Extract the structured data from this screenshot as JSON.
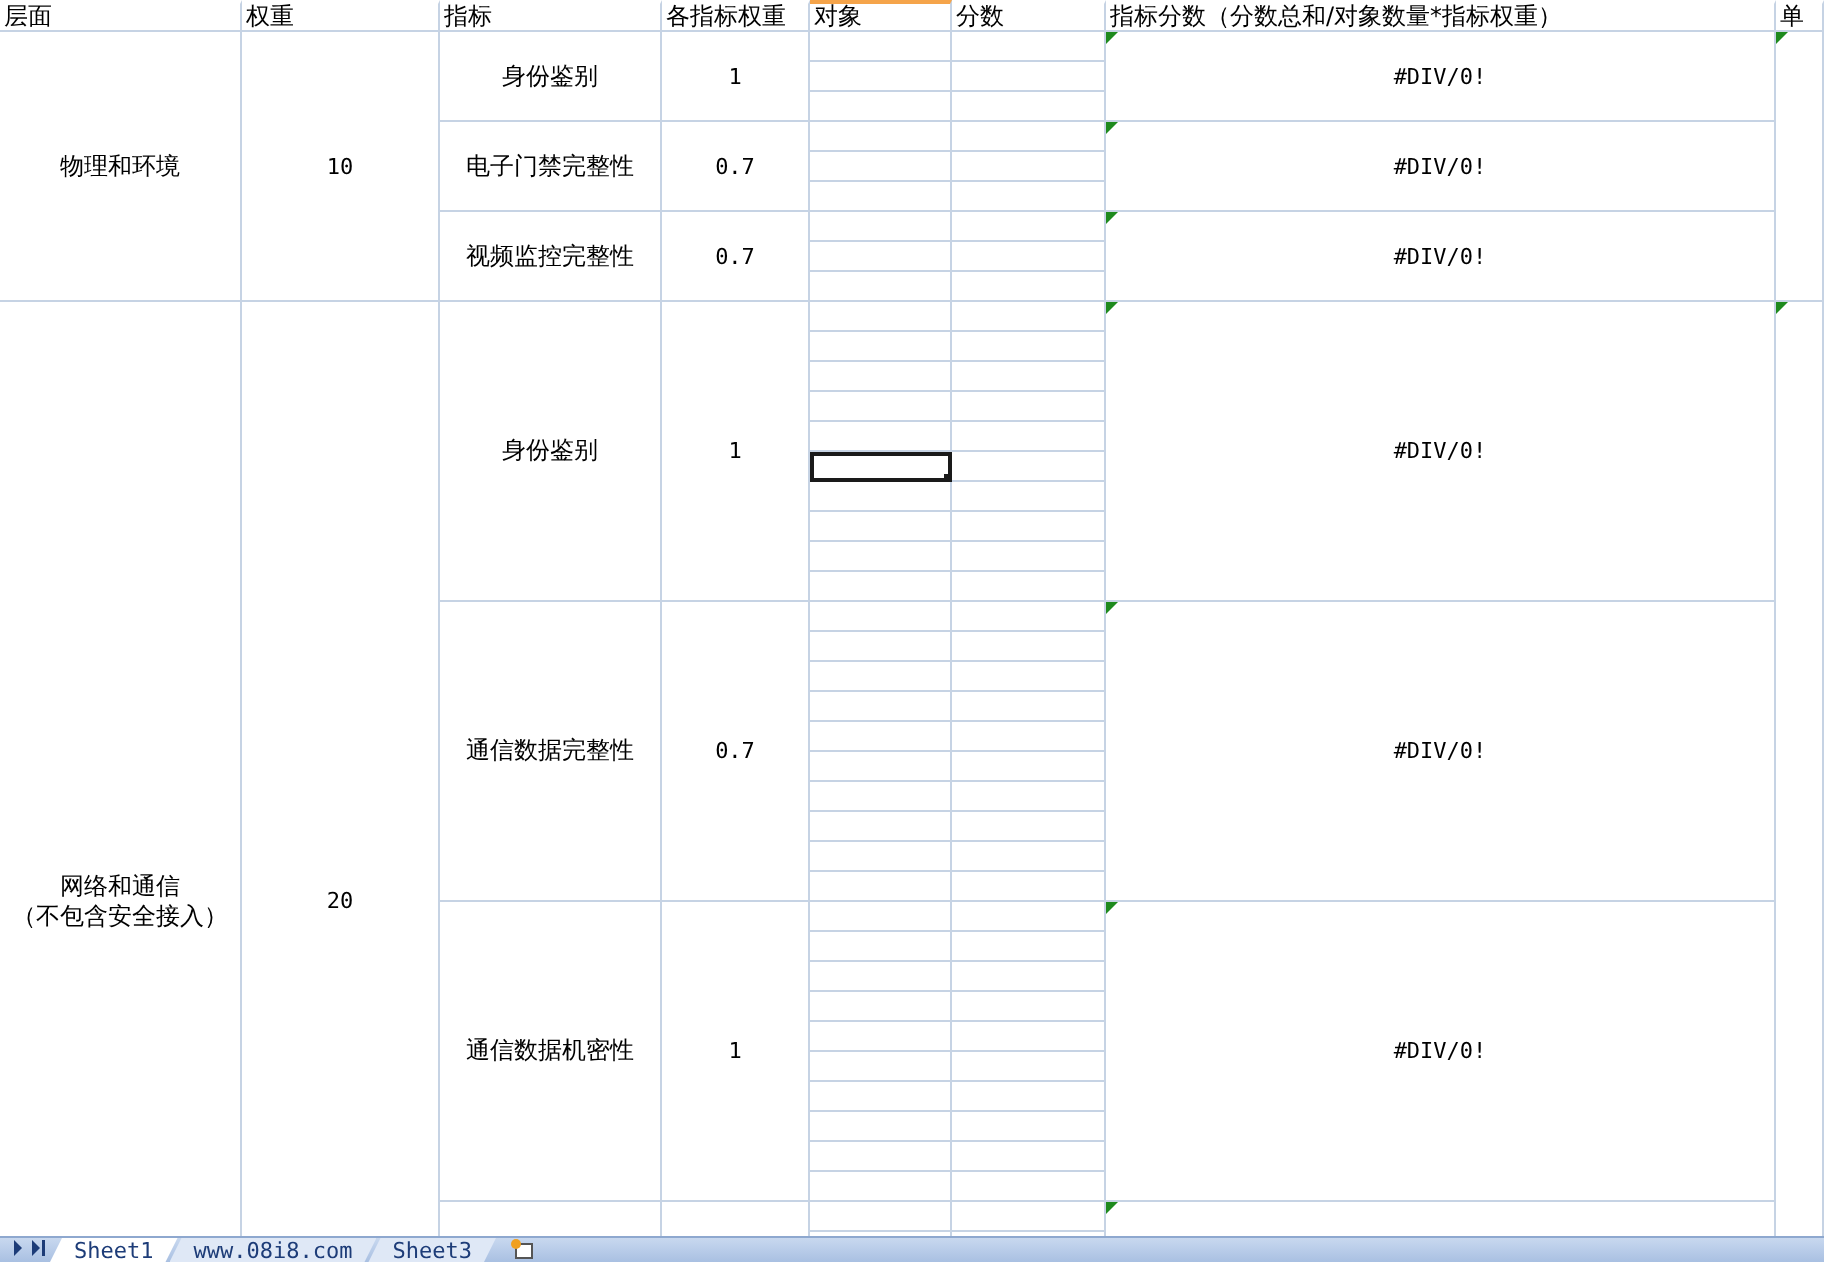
{
  "columns": [
    "层面",
    "权重",
    "指标",
    "各指标权重",
    "对象",
    "分数",
    "指标分数（分数总和/对象数量*指标权重）",
    "单"
  ],
  "groups": [
    {
      "kind": "short",
      "layer": [
        "物理和环境"
      ],
      "weight": "10",
      "flagged": true,
      "indicators": [
        {
          "name": "身份鉴别",
          "weight": "1",
          "score": "#DIV/0!",
          "flagged": true,
          "object_cells": [
            {
              "selected": false
            },
            {
              "selected": false
            },
            {
              "selected": false
            }
          ]
        },
        {
          "name": "电子门禁完整性",
          "weight": "0.7",
          "score": "#DIV/0!",
          "flagged": true,
          "object_cells": [
            {
              "selected": false
            },
            {
              "selected": false
            },
            {
              "selected": false
            }
          ]
        },
        {
          "name": "视频监控完整性",
          "weight": "0.7",
          "score": "#DIV/0!",
          "flagged": true,
          "object_cells": [
            {
              "selected": false
            },
            {
              "selected": false
            },
            {
              "selected": false
            }
          ]
        }
      ]
    },
    {
      "kind": "tall",
      "layer": [
        "网络和通信",
        "（不包含安全接入）"
      ],
      "weight": "20",
      "flagged": true,
      "indicators": [
        {
          "name": "身份鉴别",
          "weight": "1",
          "score": "#DIV/0!",
          "flagged": true,
          "object_cells": [
            {
              "selected": false
            },
            {
              "selected": false
            },
            {
              "selected": false
            },
            {
              "selected": false
            },
            {
              "selected": false
            },
            {
              "selected": true
            },
            {
              "selected": false
            },
            {
              "selected": false
            },
            {
              "selected": false
            },
            {
              "selected": false
            }
          ]
        },
        {
          "name": "通信数据完整性",
          "weight": "0.7",
          "score": "#DIV/0!",
          "flagged": true,
          "object_cells": [
            {
              "selected": false
            },
            {
              "selected": false
            },
            {
              "selected": false
            },
            {
              "selected": false
            },
            {
              "selected": false
            },
            {
              "selected": false
            },
            {
              "selected": false
            },
            {
              "selected": false
            },
            {
              "selected": false
            },
            {
              "selected": false
            }
          ]
        },
        {
          "name": "通信数据机密性",
          "weight": "1",
          "score": "#DIV/0!",
          "flagged": true,
          "object_cells": [
            {
              "selected": false
            },
            {
              "selected": false
            },
            {
              "selected": false
            },
            {
              "selected": false
            },
            {
              "selected": false
            },
            {
              "selected": false
            },
            {
              "selected": false
            },
            {
              "selected": false
            },
            {
              "selected": false
            },
            {
              "selected": false
            }
          ]
        },
        {
          "flagged": true,
          "object_cells": [
            {
              "selected": false
            },
            {
              "selected": false
            }
          ]
        }
      ]
    }
  ],
  "sheet_tabs": [
    {
      "label": "Sheet1",
      "selected": true
    },
    {
      "label": "www.08i8.com",
      "selected": false
    },
    {
      "label": "Sheet3",
      "selected": false
    }
  ]
}
